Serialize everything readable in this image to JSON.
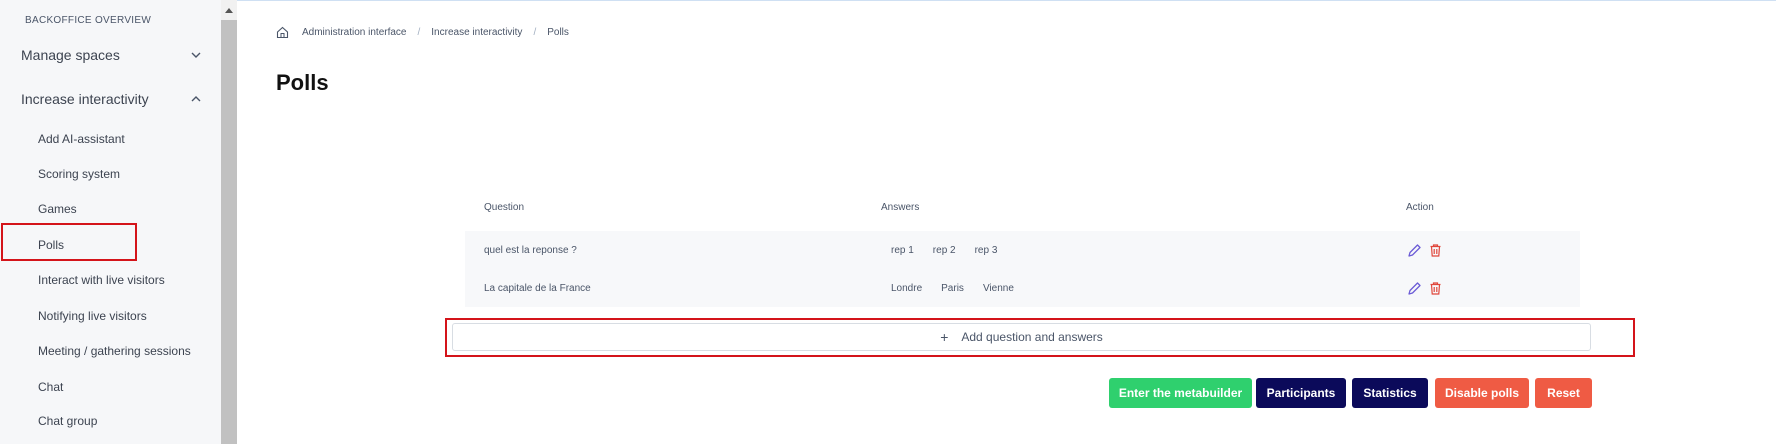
{
  "sidebar": {
    "section_title": "BACKOFFICE OVERVIEW",
    "groups": [
      {
        "label": "Manage spaces"
      },
      {
        "label": "Increase interactivity"
      }
    ],
    "items": [
      {
        "label": "Add AI-assistant"
      },
      {
        "label": "Scoring system"
      },
      {
        "label": "Games"
      },
      {
        "label": "Polls"
      },
      {
        "label": "Interact with live visitors"
      },
      {
        "label": "Notifying live visitors"
      },
      {
        "label": "Meeting / gathering sessions"
      },
      {
        "label": "Chat"
      },
      {
        "label": "Chat group"
      }
    ],
    "active_item": "Polls"
  },
  "breadcrumb": {
    "items": [
      "Administration interface",
      "Increase interactivity",
      "Polls"
    ],
    "separator": "/"
  },
  "page": {
    "title": "Polls"
  },
  "table": {
    "headers": {
      "question": "Question",
      "answers": "Answers",
      "action": "Action"
    },
    "rows": [
      {
        "question": "quel est la reponse ?",
        "answers": [
          "rep 1",
          "rep 2",
          "rep 3"
        ]
      },
      {
        "question": "La capitale de la France",
        "answers": [
          "Londre",
          "Paris",
          "Vienne"
        ]
      }
    ]
  },
  "add_button": {
    "icon": "+",
    "label": "Add question and answers"
  },
  "actions": {
    "metabuilder": "Enter the metabuilder",
    "participants": "Participants",
    "statistics": "Statistics",
    "disable": "Disable polls",
    "reset": "Reset"
  },
  "colors": {
    "green": "#2fd06e",
    "navy": "#0b0a5a",
    "red": "#ef5b44",
    "edit_icon": "#6b5bd6",
    "delete_icon": "#e0463b",
    "highlight": "#d4141a"
  }
}
